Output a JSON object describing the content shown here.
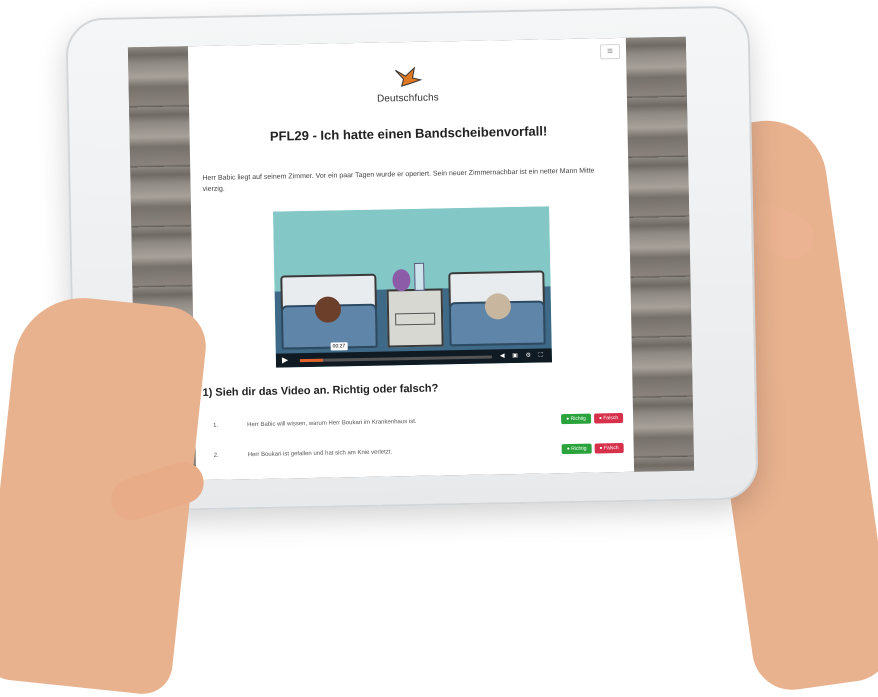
{
  "site": {
    "logo_text": "Deutschfuchs",
    "menu_icon": "hamburger-icon"
  },
  "lesson": {
    "title": "PFL29 - Ich hatte einen Bandscheibenvorfall!",
    "intro": "Herr Babic liegt auf seinem Zimmer. Vor ein paar Tagen wurde er operiert. Sein neuer Zimmernachbar ist ein netter Mann Mitte vierzig."
  },
  "video": {
    "timestamp": "00:27",
    "progress": 0.12
  },
  "exercise": {
    "heading": "1) Sieh dir das Video an. Richtig oder falsch?",
    "button_true": "● Richtig",
    "button_false": "● Falsch",
    "items": [
      {
        "number": "1.",
        "text": "Herr Babic will wissen, warum Herr Boukari im Krankenhaus ist."
      },
      {
        "number": "2.",
        "text": "Herr Boukari ist gefallen und hat sich am Knie verletzt."
      }
    ]
  },
  "colors": {
    "richtig": "#2aa33c",
    "falsch": "#d6304a",
    "logo_orange": "#e07a22"
  }
}
